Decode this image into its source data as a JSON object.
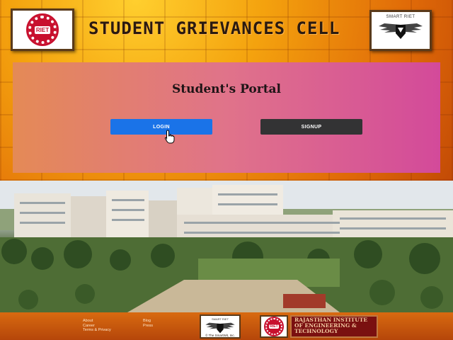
{
  "header": {
    "title": "STUDENT GRIEVANCES CELL",
    "left_logo_text": "RIET",
    "right_logo_label": "SMART RIET"
  },
  "portal": {
    "title": "Student's Portal",
    "login_label": "LOGIN",
    "signup_label": "SIGNUP"
  },
  "footer": {
    "links_col1": [
      "About",
      "Career",
      "Terms & Privacy"
    ],
    "links_col2": [
      "Blog",
      "Press"
    ],
    "smart_label": "SMART RIET",
    "copyright": "© The SmartWit, Inc.",
    "riet_logo_text": "RIET",
    "institute_name": "RAJASTHAN INSTITUTE OF ENGINEERING & TECHNOLOGY"
  },
  "colors": {
    "login_button": "#1a73e8",
    "signup_button": "#333334",
    "panel_start": "#e48a56",
    "panel_end": "#d34a9a",
    "riet_red": "#c8102e"
  },
  "icons": {
    "riet": "riet-gear-logo-icon",
    "smartriet": "winged-shield-logo-icon",
    "cursor": "hand-pointer-icon"
  }
}
